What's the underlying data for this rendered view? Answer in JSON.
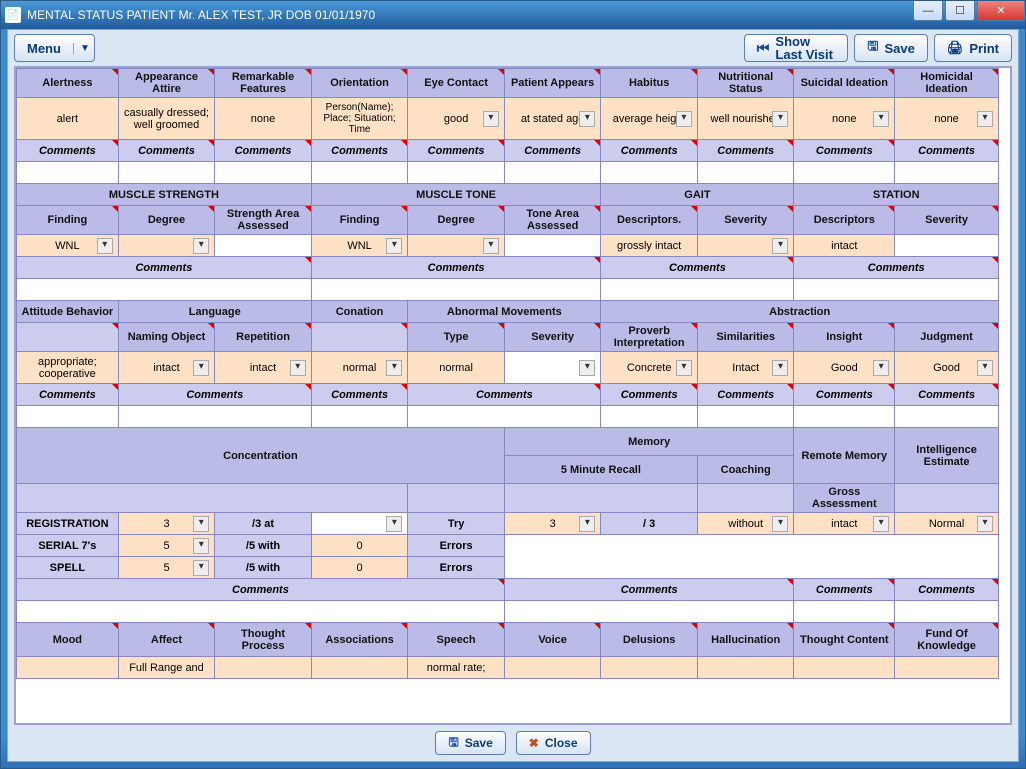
{
  "window": {
    "title": "MENTAL STATUS    PATIENT Mr. ALEX TEST, JR DOB 01/01/1970"
  },
  "toolbar": {
    "menu": "Menu",
    "showLast": "Show Last Visit",
    "save": "Save",
    "print": "Print"
  },
  "bottom": {
    "save": "Save",
    "close": "Close"
  },
  "labels": {
    "comments": "Comments"
  },
  "block1": {
    "headers": [
      "Alertness",
      "Appearance Attire",
      "Remarkable Features",
      "Orientation",
      "Eye Contact",
      "Patient Appears",
      "Habitus",
      "Nutritional Status",
      "Suicidal Ideation",
      "Homicidal Ideation"
    ],
    "values": [
      "alert",
      "casually dressed; well groomed",
      "none",
      "Person(Name); Place; Situation; Time",
      "good",
      "at stated age",
      "average height",
      "well nourished",
      "none",
      "none"
    ]
  },
  "block2": {
    "top": [
      "MUSCLE STRENGTH",
      "MUSCLE TONE",
      "GAIT",
      "STATION"
    ],
    "sub": [
      "Finding",
      "Degree",
      "Strength Area Assessed",
      "Finding",
      "Degree",
      "Tone Area Assessed",
      "Descriptors.",
      "Severity",
      "Descriptors",
      "Severity"
    ],
    "values": {
      "msFinding": "WNL",
      "msDegree": "",
      "msArea": "",
      "mtFinding": "WNL",
      "mtDegree": "",
      "mtArea": "",
      "gaitDesc": "grossly intact",
      "gaitSev": "",
      "stationDesc": "intact",
      "stationSev": ""
    }
  },
  "block3": {
    "top": [
      "Attitude Behavior",
      "Language",
      "Conation",
      "Abnormal Movements",
      "Abstraction"
    ],
    "sub": [
      "",
      "Naming Object",
      "Repetition",
      "",
      "Type",
      "Severity",
      "Proverb Interpretation",
      "Similarities",
      "Insight",
      "Judgment"
    ],
    "values": {
      "attitude": "appropriate; cooperative",
      "naming": "intact",
      "repetition": "intact",
      "conation": "normal",
      "abnType": "normal",
      "abnSev": "",
      "proverb": "Concrete",
      "similar": "Intact",
      "insight": "Good",
      "judgment": "Good"
    }
  },
  "block4": {
    "top": [
      "Concentration",
      "Memory",
      "Remote Memory",
      "Intelligence Estimate"
    ],
    "sub2": [
      "5 Minute Recall",
      "Coaching",
      "Gross Assessment"
    ],
    "rows": {
      "reg": {
        "label": "REGISTRATION",
        "score": "3",
        "of": "/3 at",
        "extra": "",
        "try": "Try",
        "recall": "3",
        "recallOf": "/ 3",
        "coach": "without",
        "remote": "intact",
        "iq": "Normal"
      },
      "s7": {
        "label": "SERIAL 7's",
        "score": "5",
        "of": "/5 with",
        "extra": "0",
        "err": "Errors"
      },
      "spell": {
        "label": "SPELL",
        "score": "5",
        "of": "/5 with",
        "extra": "0",
        "err": "Errors"
      }
    }
  },
  "block5": {
    "headers": [
      "Mood",
      "Affect",
      "Thought Process",
      "Associations",
      "Speech",
      "Voice",
      "Delusions",
      "Hallucination",
      "Thought Content",
      "Fund Of Knowledge"
    ],
    "values": [
      "",
      "Full Range and",
      "",
      "",
      "normal rate;",
      "",
      "",
      "",
      "",
      ""
    ]
  }
}
